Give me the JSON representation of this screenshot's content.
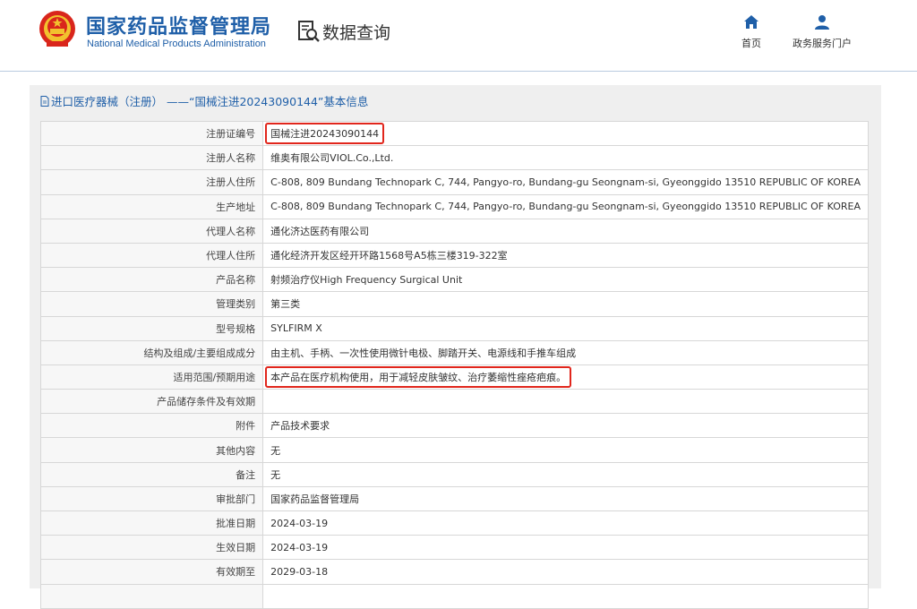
{
  "header": {
    "brand_cn": "国家药品监督管理局",
    "brand_en": "National Medical Products Administration",
    "query_title": "数据查询",
    "nav": [
      {
        "label": "首页",
        "icon": "home-icon"
      },
      {
        "label": "政务服务门户",
        "icon": "user-icon"
      }
    ]
  },
  "panel": {
    "title": "进口医疗器械（注册） ——“国械注进20243090144”基本信息"
  },
  "rows": [
    {
      "label": "注册证编号",
      "value": "国械注进20243090144",
      "highlight": true
    },
    {
      "label": "注册人名称",
      "value": "维奥有限公司VIOL.Co.,Ltd."
    },
    {
      "label": "注册人住所",
      "value": "C-808, 809 Bundang Technopark C, 744, Pangyo-ro, Bundang-gu Seongnam-si, Gyeonggido 13510 REPUBLIC OF KOREA"
    },
    {
      "label": "生产地址",
      "value": "C-808, 809 Bundang Technopark C, 744, Pangyo-ro, Bundang-gu Seongnam-si, Gyeonggido 13510 REPUBLIC OF KOREA"
    },
    {
      "label": "代理人名称",
      "value": "通化济达医药有限公司"
    },
    {
      "label": "代理人住所",
      "value": "通化经济开发区经开环路1568号A5栋三楼319-322室"
    },
    {
      "label": "产品名称",
      "value": "射频治疗仪High Frequency Surgical Unit"
    },
    {
      "label": "管理类别",
      "value": "第三类"
    },
    {
      "label": "型号规格",
      "value": "SYLFIRM X"
    },
    {
      "label": "结构及组成/主要组成成分",
      "value": "由主机、手柄、一次性使用微针电极、脚踏开关、电源线和手推车组成"
    },
    {
      "label": "适用范围/预期用途",
      "value": "本产品在医疗机构使用，用于减轻皮肤皱纹、治疗萎缩性痤疮疤痕。",
      "highlight": true
    },
    {
      "label": "产品储存条件及有效期",
      "value": ""
    },
    {
      "label": "附件",
      "value": "产品技术要求"
    },
    {
      "label": "其他内容",
      "value": "无"
    },
    {
      "label": "备注",
      "value": "无"
    },
    {
      "label": "审批部门",
      "value": "国家药品监督管理局"
    },
    {
      "label": "批准日期",
      "value": "2024-03-19"
    },
    {
      "label": "生效日期",
      "value": "2024-03-19"
    },
    {
      "label": "有效期至",
      "value": "2029-03-18"
    },
    {
      "label": "",
      "value": ""
    }
  ],
  "colors": {
    "brand": "#1f5fa8",
    "highlight": "#e1261c"
  }
}
